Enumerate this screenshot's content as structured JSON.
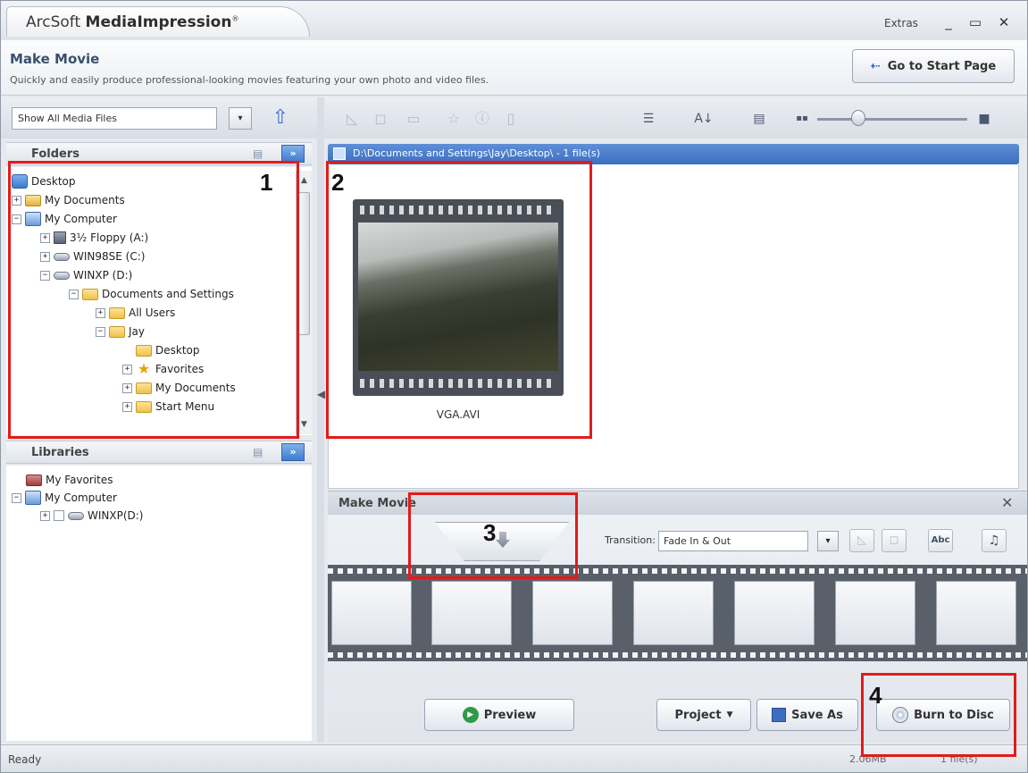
{
  "window": {
    "app_name_prefix": "ArcSoft ",
    "app_name_bold": "MediaImpression",
    "registered_mark": "®",
    "extras_label": "Extras",
    "minimize_glyph": "_",
    "maximize_glyph": "▭",
    "close_glyph": "✕"
  },
  "header": {
    "title": "Make Movie",
    "subtitle": "Quickly and easily produce professional-looking movies featuring your own photo and video files.",
    "start_button_arrow": "⇠",
    "start_button_label": "Go to Start Page"
  },
  "left_toolbar": {
    "media_filter_value": "Show All Media Files",
    "dropdown_glyph": "▾",
    "folder_up_glyph": "⇧"
  },
  "folders_panel": {
    "title": "Folders",
    "expand_glyph": "»",
    "list_glyph": "▤",
    "tree": [
      {
        "label": "Desktop",
        "expander": "",
        "icon": "desktop-icon"
      },
      {
        "label": "My Documents",
        "expander": "+",
        "icon": "documents-folder-icon"
      },
      {
        "label": "My Computer",
        "expander": "−",
        "icon": "computer-icon"
      },
      {
        "label": "3½ Floppy (A:)",
        "expander": "+",
        "icon": "floppy-icon"
      },
      {
        "label": "WIN98SE (C:)",
        "expander": "+",
        "icon": "drive-icon"
      },
      {
        "label": "WINXP (D:)",
        "expander": "−",
        "icon": "drive-icon"
      },
      {
        "label": "Documents and Settings",
        "expander": "−",
        "icon": "folder-icon"
      },
      {
        "label": "All Users",
        "expander": "+",
        "icon": "folder-icon"
      },
      {
        "label": "Jay",
        "expander": "−",
        "icon": "folder-icon"
      },
      {
        "label": "Desktop",
        "expander": "",
        "icon": "folder-icon"
      },
      {
        "label": "Favorites",
        "expander": "+",
        "icon": "star-folder-icon"
      },
      {
        "label": "My Documents",
        "expander": "+",
        "icon": "folder-icon"
      },
      {
        "label": "Start Menu",
        "expander": "+",
        "icon": "folder-icon"
      }
    ]
  },
  "libraries_panel": {
    "title": "Libraries",
    "tree": [
      {
        "label": "My Favorites",
        "expander": "",
        "icon": "favorites-icon"
      },
      {
        "label": "My Computer",
        "expander": "−",
        "icon": "computer-icon"
      },
      {
        "label": "WINXP(D:)",
        "expander": "+",
        "icon": "drive-icon"
      }
    ]
  },
  "browser": {
    "path": "D:\\Documents and Settings\\Jay\\Desktop\\ - 1 file(s)",
    "thumbnail_name": "VGA.AVI",
    "tool_glyphs": {
      "rotate_left": "◺",
      "rotate_right": "◻",
      "edit": "▭",
      "star": "☆",
      "info": "ⓘ",
      "delete": "▯",
      "sort": "☰",
      "text": "A↓",
      "view": "▤",
      "small_thumbs": "▪▪",
      "large_thumbs": "■"
    }
  },
  "make_movie": {
    "title": "Make Movie",
    "close_glyph": "✕",
    "transition_label": "Transition:",
    "transition_value": "Fade In & Out",
    "tool_rotate_left": "◺",
    "tool_rotate_right": "◻",
    "tool_text_label": "Abc",
    "tool_music": "♫",
    "preview_label": "Preview",
    "preview_glyph": "▶",
    "project_label": "Project",
    "project_caret": "▼",
    "save_as_label": "Save As",
    "burn_label": "Burn to Disc"
  },
  "status": {
    "text": "Ready",
    "size": "2.06MB",
    "count": "1 file(s)"
  },
  "callouts": [
    "1",
    "2",
    "3",
    "4"
  ]
}
